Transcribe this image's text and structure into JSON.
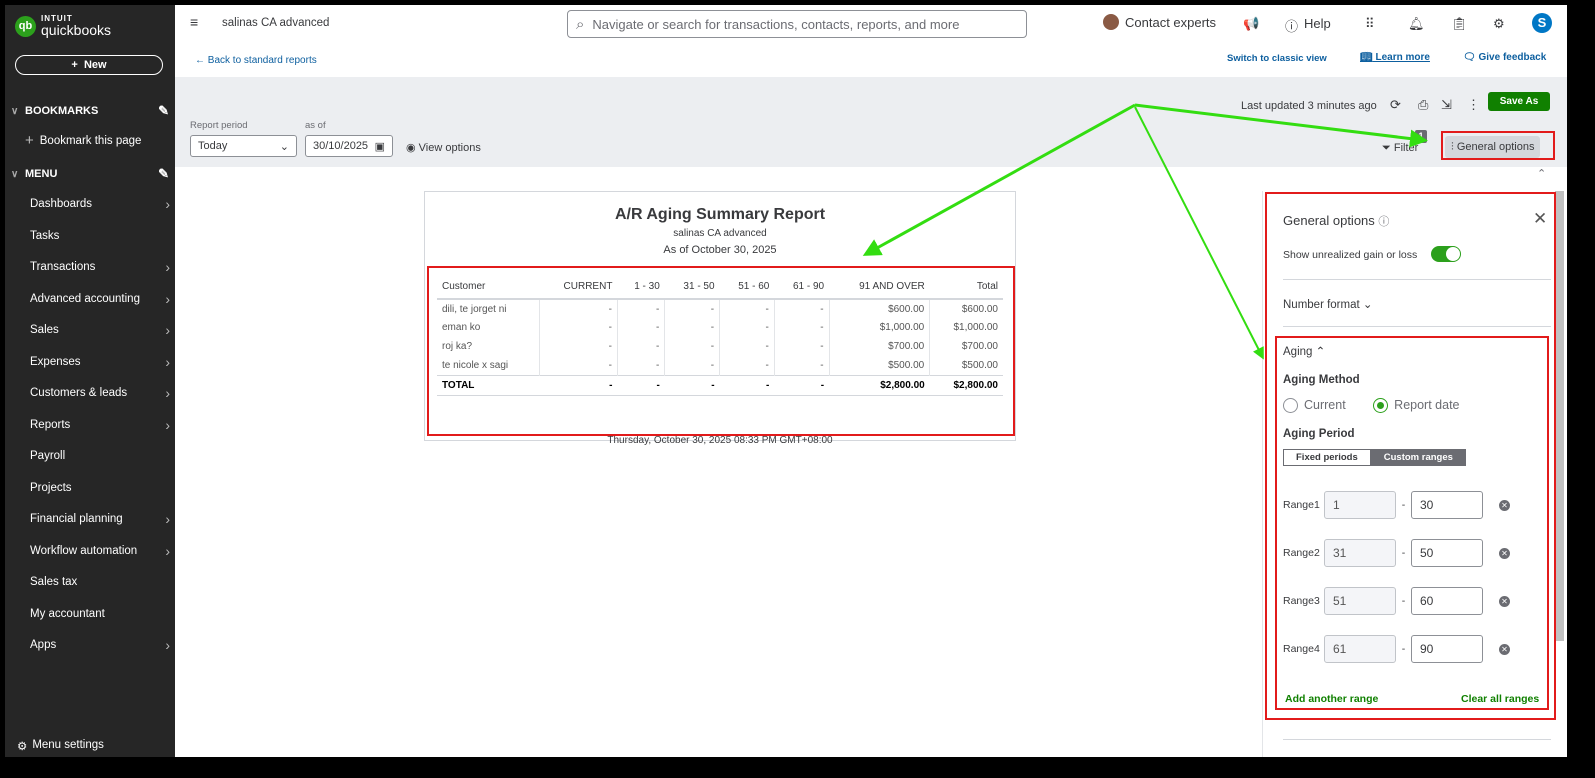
{
  "brand": {
    "top": "INTUIT",
    "name": "quickbooks",
    "badge": "qb"
  },
  "sidebar": {
    "new_label": "New",
    "bookmarks_label": "BOOKMARKS",
    "bookmark_page": "Bookmark this page",
    "menu_label": "MENU",
    "items": [
      {
        "label": "Dashboards",
        "arrow": true
      },
      {
        "label": "Tasks",
        "arrow": false
      },
      {
        "label": "Transactions",
        "arrow": true
      },
      {
        "label": "Advanced accounting",
        "arrow": true
      },
      {
        "label": "Sales",
        "arrow": true
      },
      {
        "label": "Expenses",
        "arrow": true
      },
      {
        "label": "Customers & leads",
        "arrow": true
      },
      {
        "label": "Reports",
        "arrow": true
      },
      {
        "label": "Payroll",
        "arrow": false
      },
      {
        "label": "Projects",
        "arrow": false
      },
      {
        "label": "Financial planning",
        "arrow": true
      },
      {
        "label": "Workflow automation",
        "arrow": true
      },
      {
        "label": "Sales tax",
        "arrow": false
      },
      {
        "label": "My accountant",
        "arrow": false
      },
      {
        "label": "Apps",
        "arrow": true
      }
    ],
    "menu_settings": "Menu settings"
  },
  "topbar": {
    "company": "salinas CA advanced",
    "search_placeholder": "Navigate or search for transactions, contacts, reports, and more",
    "contact_experts": "Contact experts",
    "help": "Help",
    "avatar_letter": "S"
  },
  "subbar": {
    "back": "Back to standard reports",
    "classic": "Switch to classic view",
    "learn_more": "Learn more",
    "feedback": "Give feedback"
  },
  "toolbar": {
    "last_updated": "Last updated 3 minutes ago",
    "save_as": "Save As",
    "report_period_label": "Report period",
    "report_period_value": "Today",
    "as_of_label": "as of",
    "as_of_value": "30/10/2025",
    "view_options": "View options",
    "filter": "Filter",
    "filter_count": "1",
    "general_options": "General options"
  },
  "report": {
    "title": "A/R Aging Summary Report",
    "company": "salinas CA advanced",
    "as_of": "As of October 30, 2025",
    "columns": [
      "Customer",
      "CURRENT",
      "1 - 30",
      "31 - 50",
      "51 - 60",
      "61 - 90",
      "91 AND OVER",
      "Total"
    ],
    "rows": [
      [
        "dili, te jorget ni",
        "-",
        "-",
        "-",
        "-",
        "-",
        "$600.00",
        "$600.00"
      ],
      [
        "eman ko",
        "-",
        "-",
        "-",
        "-",
        "-",
        "$1,000.00",
        "$1,000.00"
      ],
      [
        "roj ka?",
        "-",
        "-",
        "-",
        "-",
        "-",
        "$700.00",
        "$700.00"
      ],
      [
        "te nicole x sagi",
        "-",
        "-",
        "-",
        "-",
        "-",
        "$500.00",
        "$500.00"
      ]
    ],
    "total": [
      "TOTAL",
      "-",
      "-",
      "-",
      "-",
      "-",
      "$2,800.00",
      "$2,800.00"
    ],
    "footer": "Thursday, October 30, 2025 08:33 PM GMT+08:00"
  },
  "panel": {
    "title": "General options",
    "unrealized": "Show unrealized gain or loss",
    "unrealized_on": true,
    "number_format": "Number format",
    "aging": "Aging",
    "aging_method": "Aging Method",
    "method_current": "Current",
    "method_report_date": "Report date",
    "aging_period": "Aging Period",
    "fixed": "Fixed periods",
    "custom": "Custom ranges",
    "ranges": [
      {
        "label": "Range1",
        "from": "1",
        "to": "30"
      },
      {
        "label": "Range2",
        "from": "31",
        "to": "50"
      },
      {
        "label": "Range3",
        "from": "51",
        "to": "60"
      },
      {
        "label": "Range4",
        "from": "61",
        "to": "90"
      }
    ],
    "add_range": "Add another range",
    "clear_ranges": "Clear all ranges"
  },
  "colors": {
    "green": "#2ca01c",
    "annotation_red": "#e21b1b",
    "arrow_green": "#33dd11"
  }
}
